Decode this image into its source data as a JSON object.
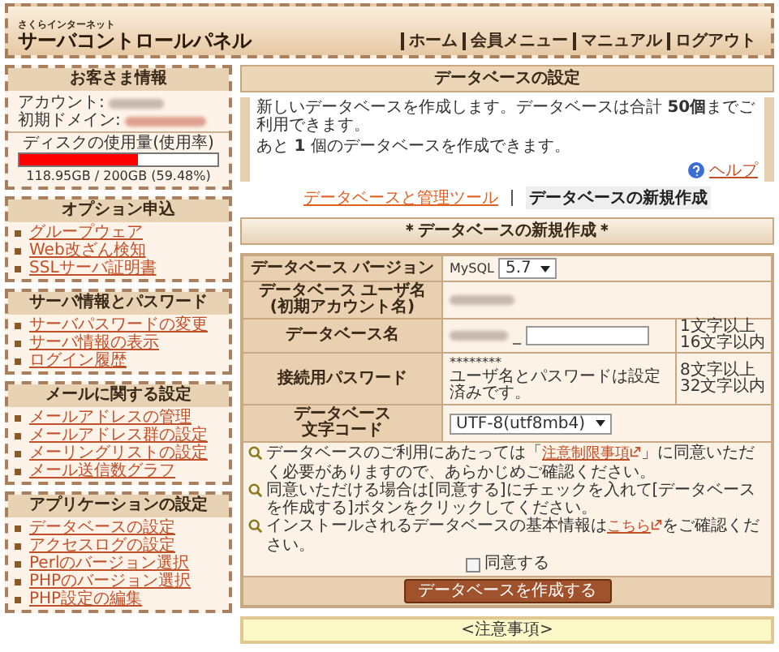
{
  "header": {
    "brand_small": "さくらインターネット",
    "brand": "サーバコントロールパネル",
    "nav": [
      "ホーム",
      "会員メニュー",
      "マニュアル",
      "ログアウト"
    ]
  },
  "customer": {
    "title": "お客さま情報",
    "account_label": "アカウント:",
    "domain_label": "初期ドメイン:",
    "disk": {
      "label": "ディスクの使用量(使用率)",
      "level": 0.5948,
      "reading": "118.95GB / 200GB (59.48%)"
    }
  },
  "menus": [
    {
      "title": "オプション申込",
      "items": [
        "グループウェア",
        "Web改ざん検知",
        "SSLサーバ証明書"
      ]
    },
    {
      "title": "サーバ情報とパスワード",
      "items": [
        "サーバパスワードの変更",
        "サーバ情報の表示",
        "ログイン履歴"
      ]
    },
    {
      "title": "メールに関する設定",
      "items": [
        "メールアドレスの管理",
        "メールアドレス群の設定",
        "メーリングリストの設定",
        "メール送信数グラフ"
      ]
    },
    {
      "title": "アプリケーションの設定",
      "items": [
        "データベースの設定",
        "アクセスログの設定",
        "Perlのバージョン選択",
        "PHPのバージョン選択",
        "PHP設定の編集"
      ]
    }
  ],
  "main": {
    "title": "データベースの設定",
    "info": [
      "新しいデータベースを作成します。データベースは合計 **50個**までご利用できます。",
      "あと **1** 個のデータベースを作成できます。"
    ],
    "help": "ヘルプ",
    "tabs": [
      {
        "label": "データベースと管理ツール",
        "selected": false
      },
      {
        "label": "データベースの新規作成",
        "selected": true
      }
    ],
    "section_title": "＊データベースの新規作成＊",
    "rows": [
      {
        "kind": "select",
        "label": [
          "データベース バージョン"
        ],
        "prefix": "MySQL",
        "value": "5.7"
      },
      {
        "kind": "redacted",
        "label": [
          "データベース ユーザ名",
          "(初期アカウント名)"
        ]
      },
      {
        "kind": "input",
        "label": [
          "データベース名"
        ],
        "suffix": "_",
        "note": [
          "1文字以上",
          "16文字以内"
        ]
      },
      {
        "kind": "password",
        "label": [
          "接続用パスワード"
        ],
        "value": "********",
        "help": "ユーザ名とパスワードは設定済みです。",
        "note": [
          "8文字以上",
          "32文字以内"
        ]
      },
      {
        "kind": "select",
        "label": [
          "データベース",
          "文字コード"
        ],
        "value": "UTF-8(utf8mb4)"
      }
    ],
    "notices": [
      {
        "before": "データベースのご利用にあたっては「",
        "link": "注意制限事項",
        "after": "」に同意いただく必要がありますので、あらかじめご確認ください。"
      },
      {
        "before": "同意いただける場合は[同意する]にチェックを入れて[データベースを作成する]ボタンをクリックしてください。"
      },
      {
        "before": "インストールされるデータベースの基本情報は",
        "link": "こちら",
        "after": "をご確認ください。"
      }
    ],
    "agree": {
      "label": "同意する",
      "checked": false
    },
    "submit": "データベースを作成する",
    "caution_title": "<注意事項>"
  }
}
